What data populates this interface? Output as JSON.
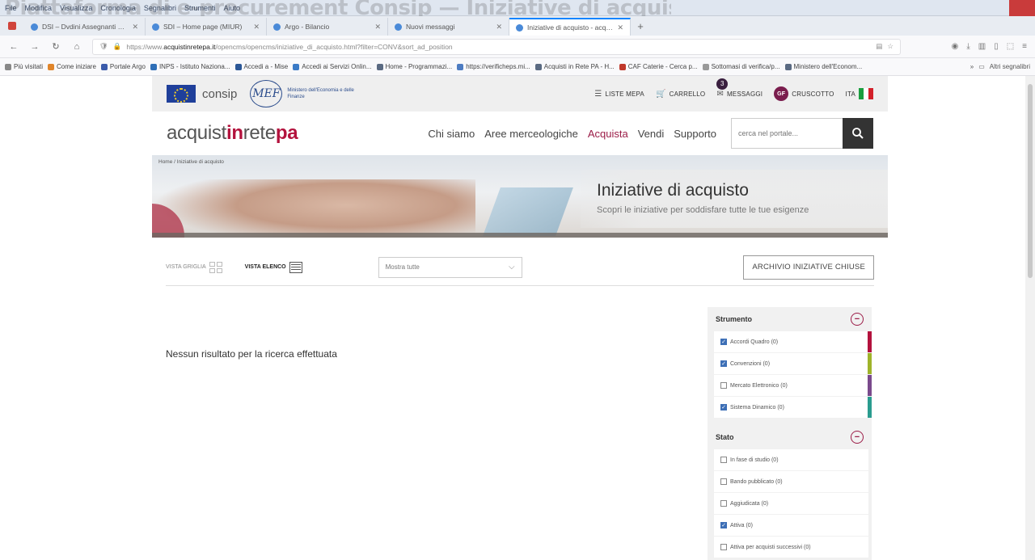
{
  "browser": {
    "caption": "Piattaforma di e-procurement Consip — Iniziative di acquisto",
    "menu": [
      "File",
      "Modifica",
      "Visualizza",
      "Cronologia",
      "Segnalibri",
      "Strumenti",
      "Aiuto"
    ],
    "tabs": [
      {
        "title": "DSI – Dvdini Assegnanti pa..."
      },
      {
        "title": "SDI – Home page (MIUR)"
      },
      {
        "title": "Argo - Bilancio"
      },
      {
        "title": "Nuovi messaggi"
      },
      {
        "title": "Iniziative di acquisto - acquistinret..."
      }
    ],
    "url_prefix": "https://www.",
    "url_host": "acquistinretepa.it",
    "url_rest": "/opencms/opencms/iniziative_di_acquisto.html?filter=CONV&sort_ad_position",
    "bookmarks": [
      "Più visitati",
      "Come iniziare",
      "Portale Argo",
      "INPS - Istituto Naziona...",
      "Accedi a - Mise",
      "Accedi ai Servizi Onlin...",
      "Home - Programmazi...",
      "https://verificheps.mi...",
      "Acquisti in Rete PA - H...",
      "CAF Caterie - Cerca p...",
      "Sottomasi di verifica/p...",
      "Ministero dell'Econom..."
    ],
    "bookmarks_right": "Altri segnalibri"
  },
  "topbar": {
    "consip": "consip",
    "mef": "MEF",
    "mef_text": "Ministero dell'Economia e delle Finanze",
    "liste": "LISTE MEPA",
    "carrello": "CARRELLO",
    "messaggi": "MESSAGGI",
    "messaggi_count": "3",
    "avatar": "GF",
    "cruscotto": "CRUSCOTTO",
    "lang": "ITA"
  },
  "header": {
    "logo_a": "acquist",
    "logo_b": "in",
    "logo_c": "rete",
    "logo_d": "pa",
    "nav": [
      "Chi siamo",
      "Aree merceologiche",
      "Acquista",
      "Vendi",
      "Supporto"
    ],
    "search_placeholder": "cerca nel portale..."
  },
  "hero": {
    "breadcrumb": "Home  /  Iniziative di acquisto",
    "title": "Iniziative di acquisto",
    "subtitle": "Scopri le iniziative per soddisfare tutte le tue esigenze"
  },
  "toolbar": {
    "vista_griglia": "VISTA GRIGLIA",
    "vista_elenco": "VISTA ELENCO",
    "select_value": "Mostra tutte",
    "archive": "ARCHIVIO INIZIATIVE CHIUSE"
  },
  "results": {
    "empty": "Nessun risultato per la ricerca effettuata"
  },
  "filters": {
    "strumento_title": "Strumento",
    "strumento": [
      {
        "label": "Accordi Quadro (0)",
        "checked": true,
        "color": "#b3123d"
      },
      {
        "label": "Convenzioni (0)",
        "checked": true,
        "color": "#9fb32a"
      },
      {
        "label": "Mercato Elettronico (0)",
        "checked": false,
        "color": "#7a4a8c"
      },
      {
        "label": "Sistema Dinamico (0)",
        "checked": true,
        "color": "#2a9c8f"
      }
    ],
    "stato_title": "Stato",
    "stato": [
      {
        "label": "In fase di studio (0)",
        "checked": false
      },
      {
        "label": "Bando pubblicato (0)",
        "checked": false
      },
      {
        "label": "Aggiudicata (0)",
        "checked": false
      },
      {
        "label": "Attiva (0)",
        "checked": true
      },
      {
        "label": "Attiva per acquisti successivi (0)",
        "checked": false
      }
    ]
  }
}
